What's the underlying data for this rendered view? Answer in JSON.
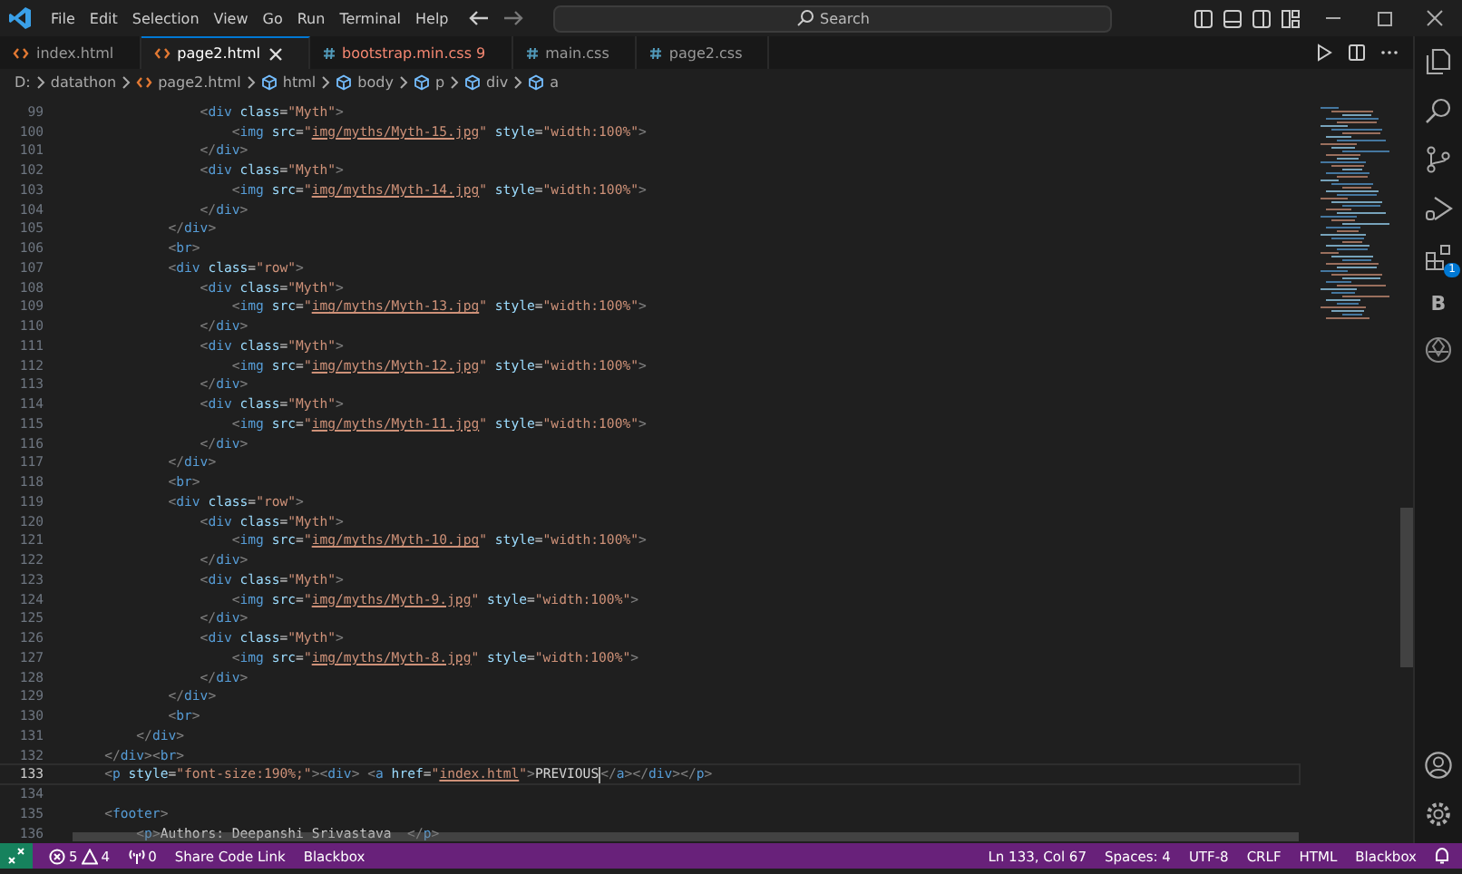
{
  "menu": [
    "File",
    "Edit",
    "Selection",
    "View",
    "Go",
    "Run",
    "Terminal",
    "Help"
  ],
  "search": {
    "placeholder": "Search"
  },
  "tabs": [
    {
      "label": "index.html",
      "kind": "html",
      "selected": false,
      "error": false
    },
    {
      "label": "page2.html",
      "kind": "html",
      "selected": true,
      "error": false
    },
    {
      "label": "bootstrap.min.css",
      "kind": "css",
      "selected": false,
      "error": true,
      "count": "9"
    },
    {
      "label": "main.css",
      "kind": "css",
      "selected": false,
      "error": false
    },
    {
      "label": "page2.css",
      "kind": "css",
      "selected": false,
      "error": false
    }
  ],
  "breadcrumbs": [
    {
      "label": "D:",
      "kind": "plain"
    },
    {
      "label": "datathon",
      "kind": "plain"
    },
    {
      "label": "page2.html",
      "kind": "file"
    },
    {
      "label": "html",
      "kind": "element"
    },
    {
      "label": "body",
      "kind": "element"
    },
    {
      "label": "p",
      "kind": "element"
    },
    {
      "label": "div",
      "kind": "element"
    },
    {
      "label": "a",
      "kind": "element"
    }
  ],
  "lines": [
    {
      "number": "99",
      "tokens": [
        {
          "kind": "p",
          "text": "                <"
        },
        {
          "kind": "t",
          "text": "div"
        },
        {
          "kind": "a",
          "text": " class"
        },
        {
          "kind": "o",
          "text": "="
        },
        {
          "kind": "s",
          "text": "\"Myth\""
        },
        {
          "kind": "p",
          "text": ">"
        }
      ]
    },
    {
      "number": "100",
      "tokens": [
        {
          "kind": "p",
          "text": "                    <"
        },
        {
          "kind": "t",
          "text": "img"
        },
        {
          "kind": "a",
          "text": " src"
        },
        {
          "kind": "o",
          "text": "="
        },
        {
          "kind": "s",
          "text": "\""
        },
        {
          "kind": "u",
          "text": "img/myths/Myth-15.jpg"
        },
        {
          "kind": "s",
          "text": "\""
        },
        {
          "kind": "a",
          "text": " style"
        },
        {
          "kind": "o",
          "text": "="
        },
        {
          "kind": "s",
          "text": "\"width:100%\""
        },
        {
          "kind": "p",
          "text": ">"
        }
      ]
    },
    {
      "number": "101",
      "tokens": [
        {
          "kind": "p",
          "text": "                </"
        },
        {
          "kind": "t",
          "text": "div"
        },
        {
          "kind": "p",
          "text": ">"
        }
      ]
    },
    {
      "number": "102",
      "tokens": [
        {
          "kind": "p",
          "text": "                <"
        },
        {
          "kind": "t",
          "text": "div"
        },
        {
          "kind": "a",
          "text": " class"
        },
        {
          "kind": "o",
          "text": "="
        },
        {
          "kind": "s",
          "text": "\"Myth\""
        },
        {
          "kind": "p",
          "text": ">"
        }
      ]
    },
    {
      "number": "103",
      "tokens": [
        {
          "kind": "p",
          "text": "                    <"
        },
        {
          "kind": "t",
          "text": "img"
        },
        {
          "kind": "a",
          "text": " src"
        },
        {
          "kind": "o",
          "text": "="
        },
        {
          "kind": "s",
          "text": "\""
        },
        {
          "kind": "u",
          "text": "img/myths/Myth-14.jpg"
        },
        {
          "kind": "s",
          "text": "\""
        },
        {
          "kind": "a",
          "text": " style"
        },
        {
          "kind": "o",
          "text": "="
        },
        {
          "kind": "s",
          "text": "\"width:100%\""
        },
        {
          "kind": "p",
          "text": ">"
        }
      ]
    },
    {
      "number": "104",
      "tokens": [
        {
          "kind": "p",
          "text": "                </"
        },
        {
          "kind": "t",
          "text": "div"
        },
        {
          "kind": "p",
          "text": ">"
        }
      ]
    },
    {
      "number": "105",
      "tokens": [
        {
          "kind": "p",
          "text": "            </"
        },
        {
          "kind": "t",
          "text": "div"
        },
        {
          "kind": "p",
          "text": ">"
        }
      ]
    },
    {
      "number": "106",
      "tokens": [
        {
          "kind": "p",
          "text": "            <"
        },
        {
          "kind": "t",
          "text": "br"
        },
        {
          "kind": "p",
          "text": ">"
        }
      ]
    },
    {
      "number": "107",
      "tokens": [
        {
          "kind": "p",
          "text": "            <"
        },
        {
          "kind": "t",
          "text": "div"
        },
        {
          "kind": "a",
          "text": " class"
        },
        {
          "kind": "o",
          "text": "="
        },
        {
          "kind": "s",
          "text": "\"row\""
        },
        {
          "kind": "p",
          "text": ">"
        }
      ]
    },
    {
      "number": "108",
      "tokens": [
        {
          "kind": "p",
          "text": "                <"
        },
        {
          "kind": "t",
          "text": "div"
        },
        {
          "kind": "a",
          "text": " class"
        },
        {
          "kind": "o",
          "text": "="
        },
        {
          "kind": "s",
          "text": "\"Myth\""
        },
        {
          "kind": "p",
          "text": ">"
        }
      ]
    },
    {
      "number": "109",
      "tokens": [
        {
          "kind": "p",
          "text": "                    <"
        },
        {
          "kind": "t",
          "text": "img"
        },
        {
          "kind": "a",
          "text": " src"
        },
        {
          "kind": "o",
          "text": "="
        },
        {
          "kind": "s",
          "text": "\""
        },
        {
          "kind": "u",
          "text": "img/myths/Myth-13.jpg"
        },
        {
          "kind": "s",
          "text": "\""
        },
        {
          "kind": "a",
          "text": " style"
        },
        {
          "kind": "o",
          "text": "="
        },
        {
          "kind": "s",
          "text": "\"width:100%\""
        },
        {
          "kind": "p",
          "text": ">"
        }
      ]
    },
    {
      "number": "110",
      "tokens": [
        {
          "kind": "p",
          "text": "                </"
        },
        {
          "kind": "t",
          "text": "div"
        },
        {
          "kind": "p",
          "text": ">"
        }
      ]
    },
    {
      "number": "111",
      "tokens": [
        {
          "kind": "p",
          "text": "                <"
        },
        {
          "kind": "t",
          "text": "div"
        },
        {
          "kind": "a",
          "text": " class"
        },
        {
          "kind": "o",
          "text": "="
        },
        {
          "kind": "s",
          "text": "\"Myth\""
        },
        {
          "kind": "p",
          "text": ">"
        }
      ]
    },
    {
      "number": "112",
      "tokens": [
        {
          "kind": "p",
          "text": "                    <"
        },
        {
          "kind": "t",
          "text": "img"
        },
        {
          "kind": "a",
          "text": " src"
        },
        {
          "kind": "o",
          "text": "="
        },
        {
          "kind": "s",
          "text": "\""
        },
        {
          "kind": "u",
          "text": "img/myths/Myth-12.jpg"
        },
        {
          "kind": "s",
          "text": "\""
        },
        {
          "kind": "a",
          "text": " style"
        },
        {
          "kind": "o",
          "text": "="
        },
        {
          "kind": "s",
          "text": "\"width:100%\""
        },
        {
          "kind": "p",
          "text": ">"
        }
      ]
    },
    {
      "number": "113",
      "tokens": [
        {
          "kind": "p",
          "text": "                </"
        },
        {
          "kind": "t",
          "text": "div"
        },
        {
          "kind": "p",
          "text": ">"
        }
      ]
    },
    {
      "number": "114",
      "tokens": [
        {
          "kind": "p",
          "text": "                <"
        },
        {
          "kind": "t",
          "text": "div"
        },
        {
          "kind": "a",
          "text": " class"
        },
        {
          "kind": "o",
          "text": "="
        },
        {
          "kind": "s",
          "text": "\"Myth\""
        },
        {
          "kind": "p",
          "text": ">"
        }
      ]
    },
    {
      "number": "115",
      "tokens": [
        {
          "kind": "p",
          "text": "                    <"
        },
        {
          "kind": "t",
          "text": "img"
        },
        {
          "kind": "a",
          "text": " src"
        },
        {
          "kind": "o",
          "text": "="
        },
        {
          "kind": "s",
          "text": "\""
        },
        {
          "kind": "u",
          "text": "img/myths/Myth-11.jpg"
        },
        {
          "kind": "s",
          "text": "\""
        },
        {
          "kind": "a",
          "text": " style"
        },
        {
          "kind": "o",
          "text": "="
        },
        {
          "kind": "s",
          "text": "\"width:100%\""
        },
        {
          "kind": "p",
          "text": ">"
        }
      ]
    },
    {
      "number": "116",
      "tokens": [
        {
          "kind": "p",
          "text": "                </"
        },
        {
          "kind": "t",
          "text": "div"
        },
        {
          "kind": "p",
          "text": ">"
        }
      ]
    },
    {
      "number": "117",
      "tokens": [
        {
          "kind": "p",
          "text": "            </"
        },
        {
          "kind": "t",
          "text": "div"
        },
        {
          "kind": "p",
          "text": ">"
        }
      ]
    },
    {
      "number": "118",
      "tokens": [
        {
          "kind": "p",
          "text": "            <"
        },
        {
          "kind": "t",
          "text": "br"
        },
        {
          "kind": "p",
          "text": ">"
        }
      ]
    },
    {
      "number": "119",
      "tokens": [
        {
          "kind": "p",
          "text": "            <"
        },
        {
          "kind": "t",
          "text": "div"
        },
        {
          "kind": "a",
          "text": " class"
        },
        {
          "kind": "o",
          "text": "="
        },
        {
          "kind": "s",
          "text": "\"row\""
        },
        {
          "kind": "p",
          "text": ">"
        }
      ]
    },
    {
      "number": "120",
      "tokens": [
        {
          "kind": "p",
          "text": "                <"
        },
        {
          "kind": "t",
          "text": "div"
        },
        {
          "kind": "a",
          "text": " class"
        },
        {
          "kind": "o",
          "text": "="
        },
        {
          "kind": "s",
          "text": "\"Myth\""
        },
        {
          "kind": "p",
          "text": ">"
        }
      ]
    },
    {
      "number": "121",
      "tokens": [
        {
          "kind": "p",
          "text": "                    <"
        },
        {
          "kind": "t",
          "text": "img"
        },
        {
          "kind": "a",
          "text": " src"
        },
        {
          "kind": "o",
          "text": "="
        },
        {
          "kind": "s",
          "text": "\""
        },
        {
          "kind": "u",
          "text": "img/myths/Myth-10.jpg"
        },
        {
          "kind": "s",
          "text": "\""
        },
        {
          "kind": "a",
          "text": " style"
        },
        {
          "kind": "o",
          "text": "="
        },
        {
          "kind": "s",
          "text": "\"width:100%\""
        },
        {
          "kind": "p",
          "text": ">"
        }
      ]
    },
    {
      "number": "122",
      "tokens": [
        {
          "kind": "p",
          "text": "                </"
        },
        {
          "kind": "t",
          "text": "div"
        },
        {
          "kind": "p",
          "text": ">"
        }
      ]
    },
    {
      "number": "123",
      "tokens": [
        {
          "kind": "p",
          "text": "                <"
        },
        {
          "kind": "t",
          "text": "div"
        },
        {
          "kind": "a",
          "text": " class"
        },
        {
          "kind": "o",
          "text": "="
        },
        {
          "kind": "s",
          "text": "\"Myth\""
        },
        {
          "kind": "p",
          "text": ">"
        }
      ]
    },
    {
      "number": "124",
      "tokens": [
        {
          "kind": "p",
          "text": "                    <"
        },
        {
          "kind": "t",
          "text": "img"
        },
        {
          "kind": "a",
          "text": " src"
        },
        {
          "kind": "o",
          "text": "="
        },
        {
          "kind": "s",
          "text": "\""
        },
        {
          "kind": "u",
          "text": "img/myths/Myth-9.jpg"
        },
        {
          "kind": "s",
          "text": "\""
        },
        {
          "kind": "a",
          "text": " style"
        },
        {
          "kind": "o",
          "text": "="
        },
        {
          "kind": "s",
          "text": "\"width:100%\""
        },
        {
          "kind": "p",
          "text": ">"
        }
      ]
    },
    {
      "number": "125",
      "tokens": [
        {
          "kind": "p",
          "text": "                </"
        },
        {
          "kind": "t",
          "text": "div"
        },
        {
          "kind": "p",
          "text": ">"
        }
      ]
    },
    {
      "number": "126",
      "tokens": [
        {
          "kind": "p",
          "text": "                <"
        },
        {
          "kind": "t",
          "text": "div"
        },
        {
          "kind": "a",
          "text": " class"
        },
        {
          "kind": "o",
          "text": "="
        },
        {
          "kind": "s",
          "text": "\"Myth\""
        },
        {
          "kind": "p",
          "text": ">"
        }
      ]
    },
    {
      "number": "127",
      "tokens": [
        {
          "kind": "p",
          "text": "                    <"
        },
        {
          "kind": "t",
          "text": "img"
        },
        {
          "kind": "a",
          "text": " src"
        },
        {
          "kind": "o",
          "text": "="
        },
        {
          "kind": "s",
          "text": "\""
        },
        {
          "kind": "u",
          "text": "img/myths/Myth-8.jpg"
        },
        {
          "kind": "s",
          "text": "\""
        },
        {
          "kind": "a",
          "text": " style"
        },
        {
          "kind": "o",
          "text": "="
        },
        {
          "kind": "s",
          "text": "\"width:100%\""
        },
        {
          "kind": "p",
          "text": ">"
        }
      ]
    },
    {
      "number": "128",
      "tokens": [
        {
          "kind": "p",
          "text": "                </"
        },
        {
          "kind": "t",
          "text": "div"
        },
        {
          "kind": "p",
          "text": ">"
        }
      ]
    },
    {
      "number": "129",
      "tokens": [
        {
          "kind": "p",
          "text": "            </"
        },
        {
          "kind": "t",
          "text": "div"
        },
        {
          "kind": "p",
          "text": ">"
        }
      ]
    },
    {
      "number": "130",
      "tokens": [
        {
          "kind": "p",
          "text": "            <"
        },
        {
          "kind": "t",
          "text": "br"
        },
        {
          "kind": "p",
          "text": ">"
        }
      ]
    },
    {
      "number": "131",
      "tokens": [
        {
          "kind": "p",
          "text": "        </"
        },
        {
          "kind": "t",
          "text": "div"
        },
        {
          "kind": "p",
          "text": ">"
        }
      ]
    },
    {
      "number": "132",
      "tokens": [
        {
          "kind": "p",
          "text": "    </"
        },
        {
          "kind": "t",
          "text": "div"
        },
        {
          "kind": "p",
          "text": "><"
        },
        {
          "kind": "t",
          "text": "br"
        },
        {
          "kind": "p",
          "text": ">"
        }
      ]
    },
    {
      "number": "133",
      "current": true,
      "tokens": [
        {
          "kind": "p",
          "text": "    <"
        },
        {
          "kind": "t",
          "text": "p"
        },
        {
          "kind": "a",
          "text": " style"
        },
        {
          "kind": "o",
          "text": "="
        },
        {
          "kind": "s",
          "text": "\"font-size:190%;\""
        },
        {
          "kind": "p",
          "text": "><"
        },
        {
          "kind": "t",
          "text": "div"
        },
        {
          "kind": "p",
          "text": "> <"
        },
        {
          "kind": "t",
          "text": "a"
        },
        {
          "kind": "a",
          "text": " href"
        },
        {
          "kind": "o",
          "text": "="
        },
        {
          "kind": "s",
          "text": "\""
        },
        {
          "kind": "u",
          "text": "index.html"
        },
        {
          "kind": "s",
          "text": "\""
        },
        {
          "kind": "p",
          "text": ">"
        },
        {
          "kind": "x",
          "text": "PREVIOUS"
        },
        {
          "kind": "p",
          "text": "</"
        },
        {
          "kind": "t",
          "text": "a"
        },
        {
          "kind": "p",
          "text": "></"
        },
        {
          "kind": "t",
          "text": "div"
        },
        {
          "kind": "p",
          "text": "></"
        },
        {
          "kind": "t",
          "text": "p"
        },
        {
          "kind": "p",
          "text": ">"
        }
      ]
    },
    {
      "number": "134"
    },
    {
      "number": "135",
      "tokens": [
        {
          "kind": "p",
          "text": "    <"
        },
        {
          "kind": "t",
          "text": "footer"
        },
        {
          "kind": "p",
          "text": ">"
        }
      ]
    },
    {
      "number": "136",
      "tokens": [
        {
          "kind": "p",
          "text": "        <"
        },
        {
          "kind": "t",
          "text": "p"
        },
        {
          "kind": "p",
          "text": ">"
        },
        {
          "kind": "x",
          "text": "Authors: Deepanshi Srivastava  "
        },
        {
          "kind": "p",
          "text": "</"
        },
        {
          "kind": "t",
          "text": "p"
        },
        {
          "kind": "p",
          "text": ">"
        }
      ]
    }
  ],
  "extensions_badge": "1",
  "blackbox_letter": "B",
  "status_bar": {
    "errors": "5",
    "warnings": "4",
    "ports": "0",
    "left": [
      "Share Code Link",
      "Blackbox"
    ],
    "right": [
      "Ln 133, Col 67",
      "Spaces: 4",
      "UTF-8",
      "CRLF",
      "HTML",
      "Blackbox"
    ]
  }
}
